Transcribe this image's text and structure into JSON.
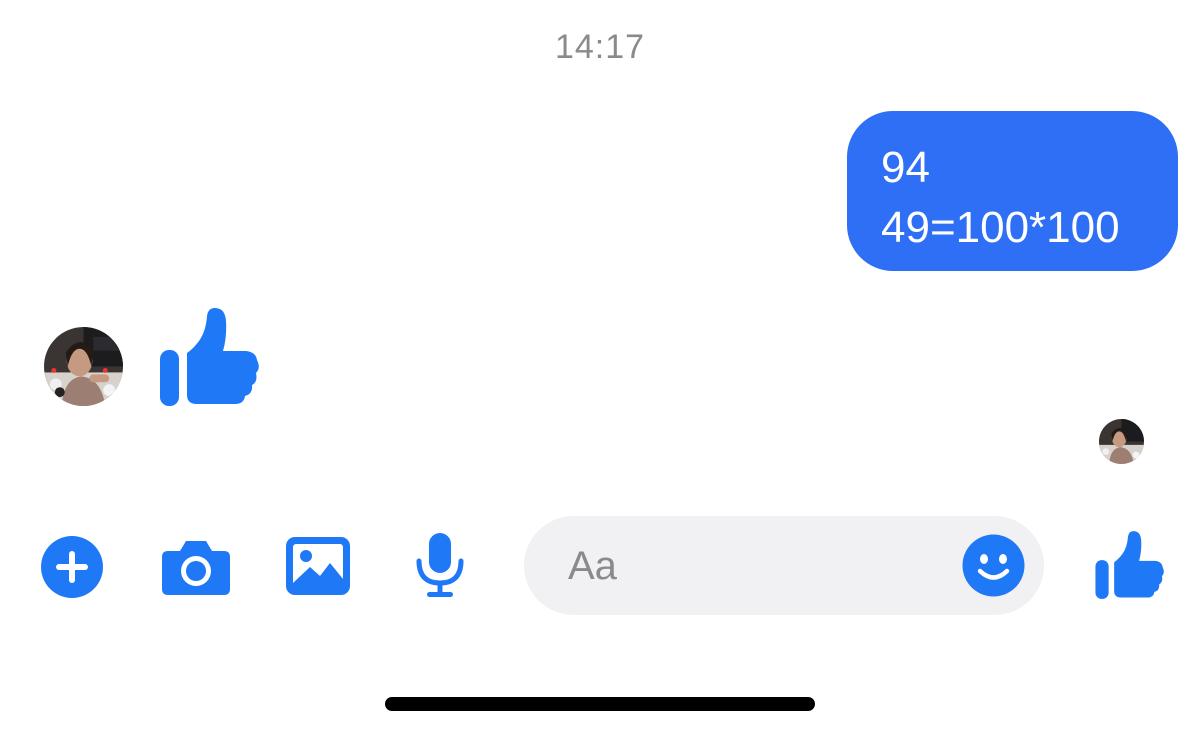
{
  "conversation": {
    "timestamp": "14:17",
    "outgoing_message": {
      "lines": [
        "94",
        "49=100*100"
      ]
    },
    "incoming_reaction": {
      "type": "thumbs-up-icon"
    }
  },
  "composer": {
    "placeholder": "Aa"
  },
  "toolbar": {
    "icons": [
      "plus-icon",
      "camera-icon",
      "gallery-icon",
      "microphone-icon",
      "emoji-icon",
      "thumbs-up-icon"
    ]
  },
  "colors": {
    "accent": "#2f6ff6",
    "icon_blue": "#1f78f5",
    "composer_bg": "#f1f1f3",
    "timestamp_gray": "#8a8a8e"
  }
}
